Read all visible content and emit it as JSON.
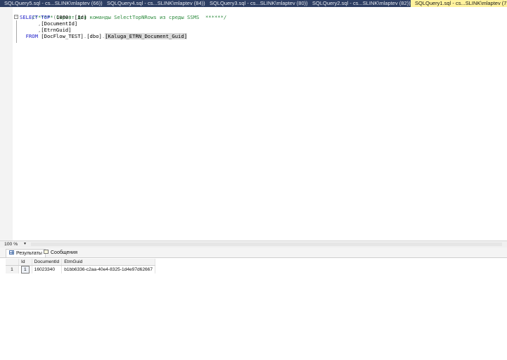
{
  "tabs": [
    {
      "label": "SQLQuery5.sql - cs...SLINK\\mlaptev (66))*",
      "active": false
    },
    {
      "label": "SQLQuery4.sql - cs...SLINK\\mlaptev (84))",
      "active": false
    },
    {
      "label": "SQLQuery3.sql - cs...SLINK\\mlaptev (80))",
      "active": false
    },
    {
      "label": "SQLQuery2.sql - cs...SLINK\\mlaptev (82))",
      "active": false
    },
    {
      "label": "SQLQuery1.sql - cs...SLINK\\mlaptev (77))",
      "active": true
    }
  ],
  "editor": {
    "comment": "/****** Скрипт для команды SelectTopNRows из среды SSMS  ******/",
    "line2": {
      "kw_select": "SELECT",
      "kw_top": "TOP",
      "paren_open": "(",
      "num": "1000",
      "paren_close": ")",
      "col": "[Id]"
    },
    "line3": {
      "comma": ",",
      "col": "[DocumentId]"
    },
    "line4": {
      "comma": ",",
      "col": "[EtrnGuid]"
    },
    "line5": {
      "kw_from": "FROM",
      "db": "[DocFlow_TEST]",
      "dot1": ".",
      "schema": "[dbo]",
      "dot2": ".",
      "table": "[Kaluga_ETRN_Document_Guid]"
    }
  },
  "zoom": {
    "value": "100 %",
    "arrow": "▾"
  },
  "result_tabs": [
    {
      "label": "Результаты",
      "icon": "grid-icon",
      "active": true
    },
    {
      "label": "Сообщения",
      "icon": "messages-icon",
      "active": false
    }
  ],
  "grid": {
    "columns": [
      "Id",
      "DocumentId",
      "EtrnGuid"
    ],
    "rows": [
      {
        "rownum": "1",
        "cells": [
          "1",
          "16023340",
          "b1bb6336-c2aa-40e4-8325-1d4e97d62667"
        ]
      }
    ]
  }
}
